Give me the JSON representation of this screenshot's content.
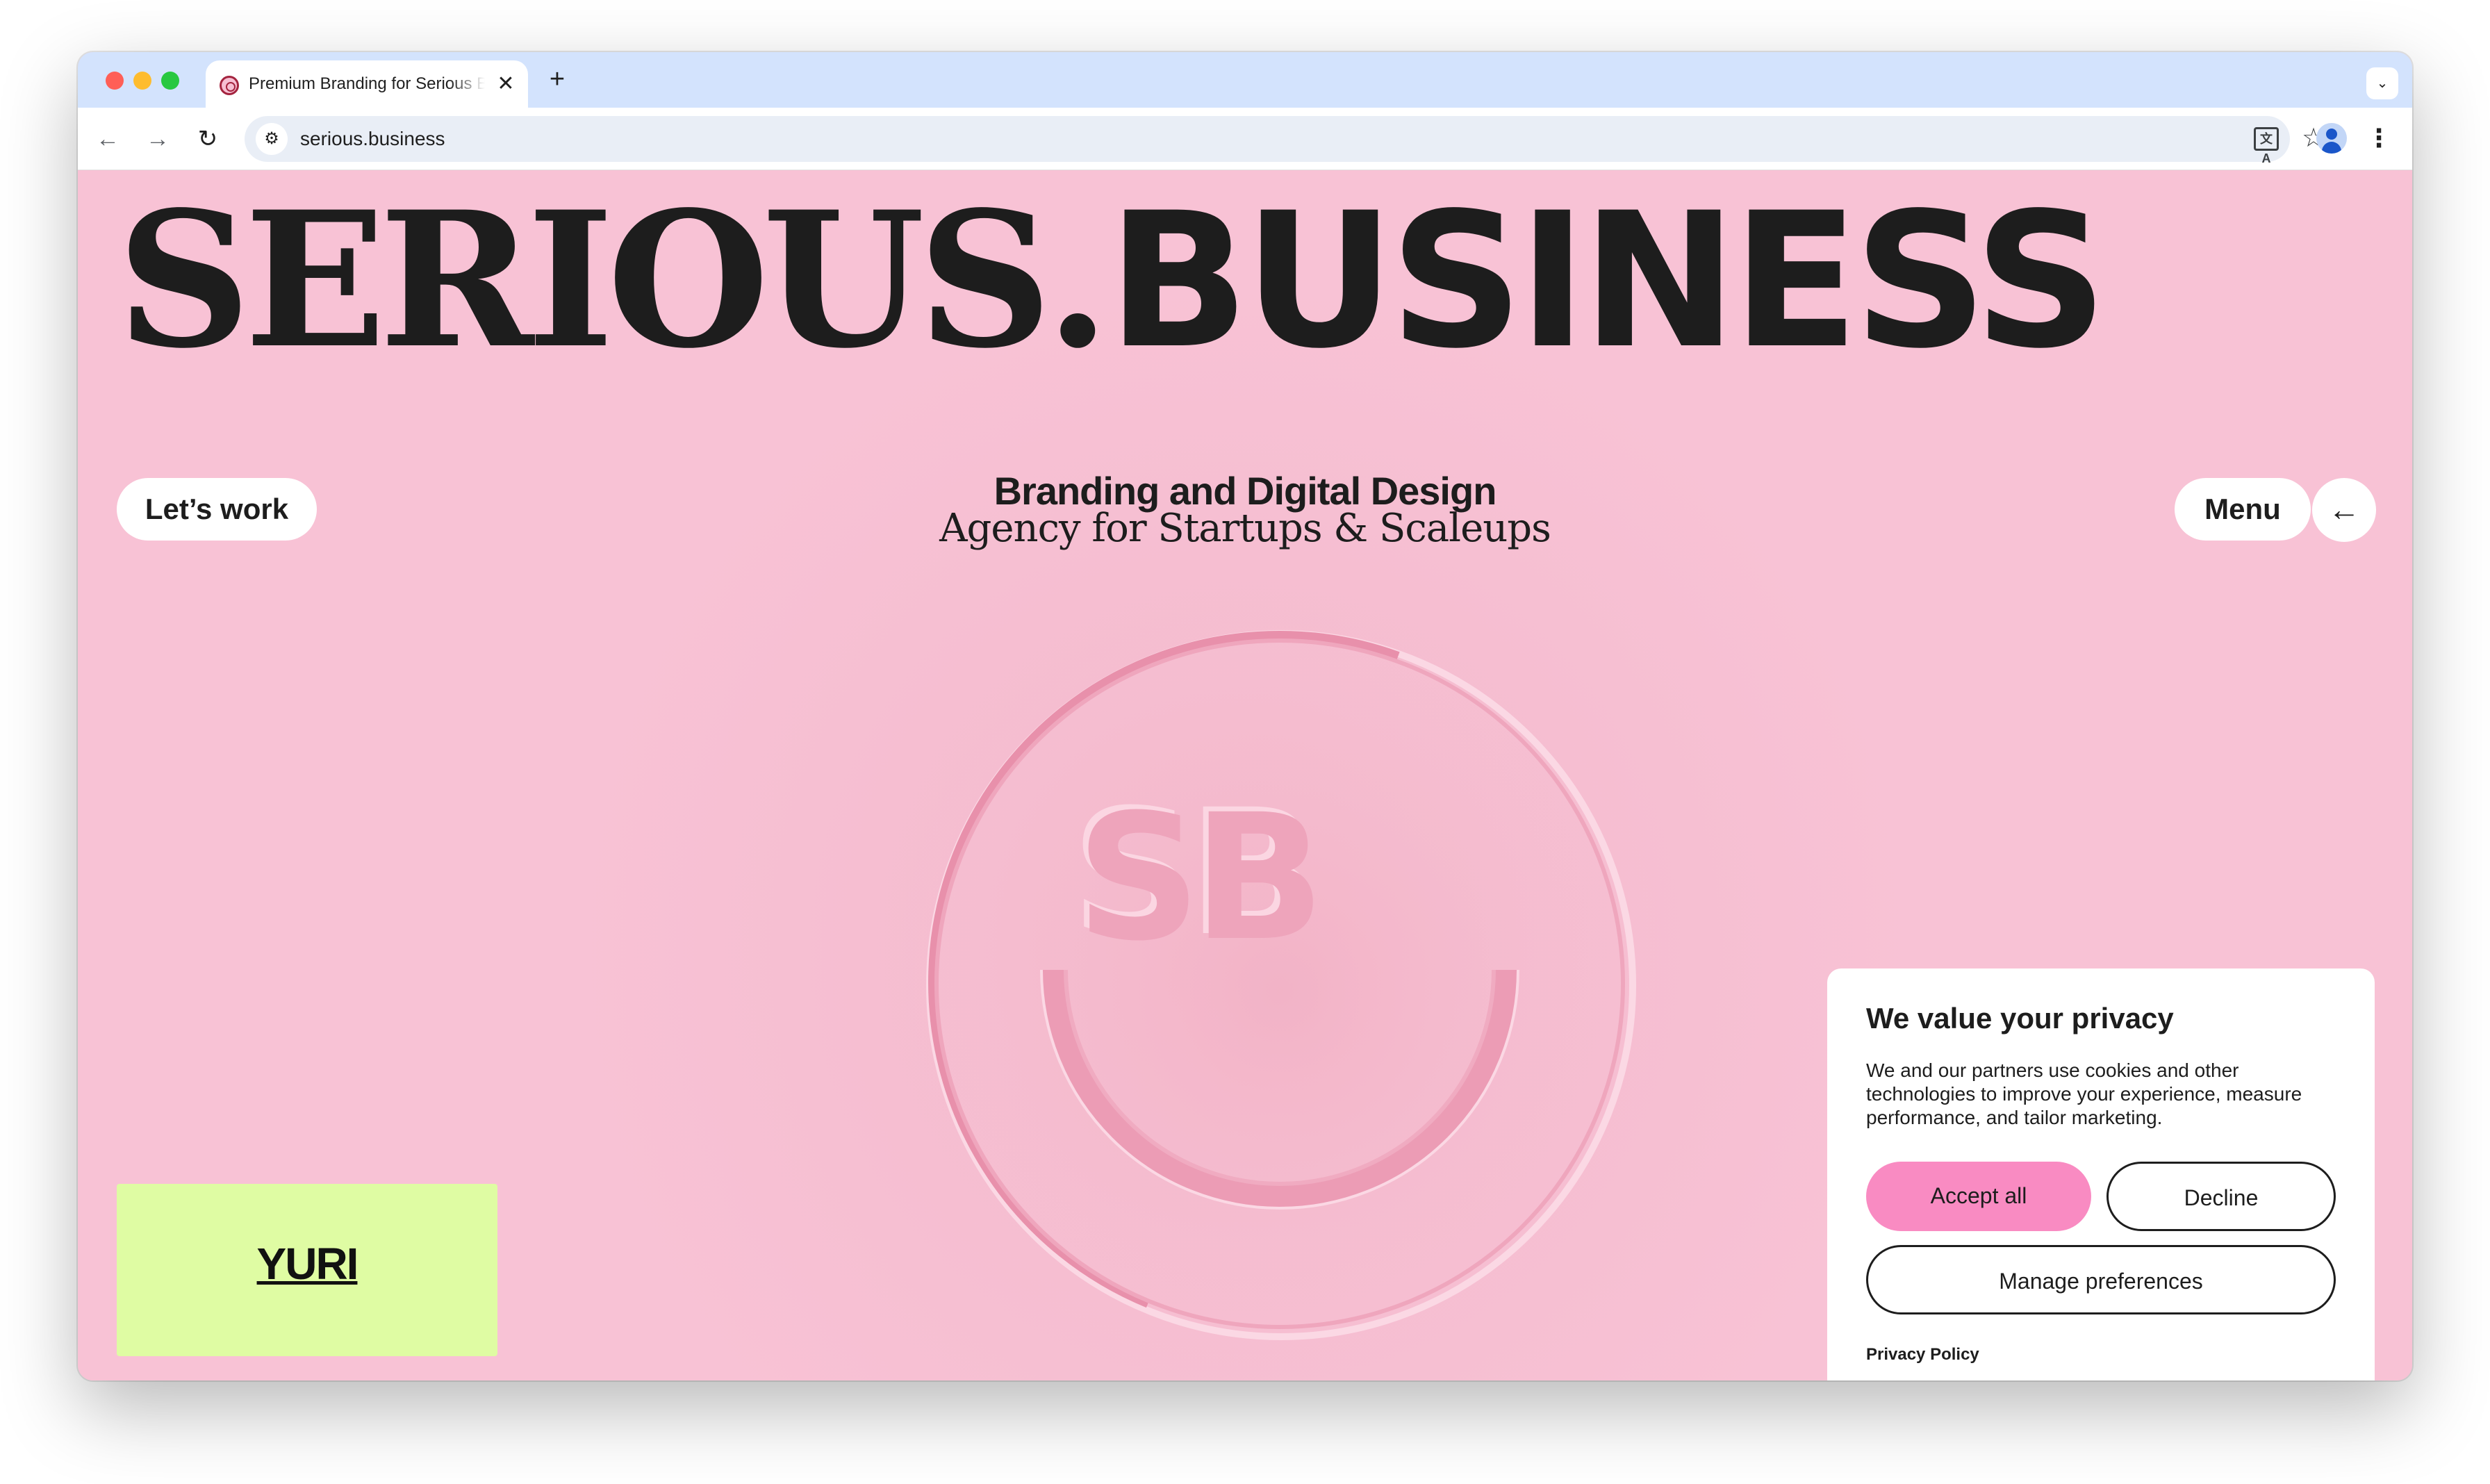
{
  "browser": {
    "tab_title": "Premium Branding for Serious Business",
    "tab_close": "✕",
    "new_tab": "+",
    "tab_menu": "⌄",
    "back": "←",
    "forward": "→",
    "reload": "↻",
    "site_info": "⚙",
    "url": "serious.business",
    "translate": "文A",
    "bookmark": "☆",
    "more": "⋮"
  },
  "page": {
    "headline_part1": "SERIOUS",
    "headline_dot": ".",
    "headline_part2": "BUSINESS",
    "lets_work": "Let’s work",
    "tagline_line1": "Branding and Digital Design",
    "tagline_line2": "Agency for Startups & Scaleups",
    "menu": "Menu",
    "arrow": "←",
    "logo_text": "SB",
    "yuri": "YURI"
  },
  "cookie": {
    "title": "We value your privacy",
    "body": "We and our partners use cookies and other technologies to improve your experience, measure performance, and tailor marketing.",
    "accept": "Accept all",
    "decline": "Decline",
    "manage": "Manage preferences",
    "privacy_link": "Privacy Policy"
  },
  "colors": {
    "page_bg": "#f8c2d5",
    "ink": "#1d1d1d",
    "accept_pink": "#f98bc2",
    "card_green": "#dffca3",
    "chrome_blue": "#d3e3fd"
  }
}
